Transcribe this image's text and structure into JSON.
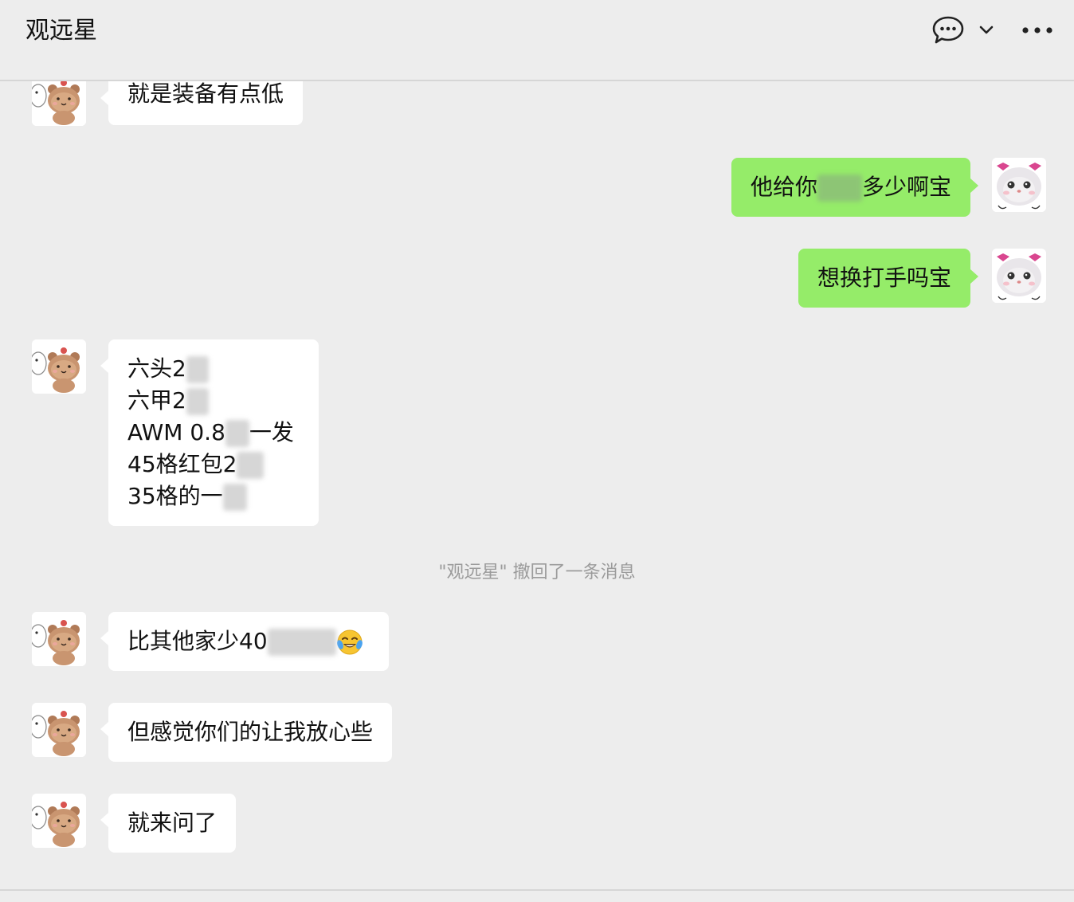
{
  "chat": {
    "title": "观远星"
  },
  "header_icons": [
    "chat-bubble-icon",
    "chevron-down-icon",
    "more-icon"
  ],
  "messages": [
    {
      "side": "left",
      "text": "就是装备有点低"
    },
    {
      "side": "right",
      "pre": "他给你",
      "post": "多少啊宝"
    },
    {
      "side": "right",
      "text": "想换打手吗宝"
    },
    {
      "side": "left",
      "lines": [
        {
          "pre": "六头2",
          "post": ""
        },
        {
          "pre": "六甲2",
          "post": ""
        },
        {
          "pre": "AWM  0.8",
          "post": "一发"
        },
        {
          "pre": "45格红包2",
          "post": ""
        },
        {
          "pre": "35格的一",
          "post": ""
        }
      ]
    },
    {
      "side": "system",
      "text": "\"观远星\" 撤回了一条消息"
    },
    {
      "side": "left",
      "pre": "比其他家少40",
      "emoji": "crying-laughing-emoji"
    },
    {
      "side": "left",
      "text": "但感觉你们的让我放心些"
    },
    {
      "side": "left",
      "text": "就来问了"
    }
  ],
  "colors": {
    "background": "#ededed",
    "incoming_bubble": "#ffffff",
    "outgoing_bubble": "#95ec69",
    "system_text": "#9b9b9b"
  }
}
